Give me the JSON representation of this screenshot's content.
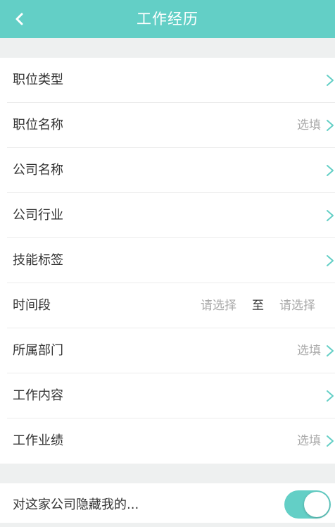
{
  "header": {
    "title": "工作经历",
    "back_icon": "chevron-left-icon"
  },
  "colors": {
    "accent": "#63cfc6",
    "background": "#eef0f0",
    "text": "#333333",
    "hint": "#a9a9a9"
  },
  "form": {
    "rows": [
      {
        "label": "职位类型",
        "hint": ""
      },
      {
        "label": "职位名称",
        "hint": "选填"
      },
      {
        "label": "公司名称",
        "hint": ""
      },
      {
        "label": "公司行业",
        "hint": ""
      },
      {
        "label": "技能标签",
        "hint": ""
      },
      {
        "label": "时间段",
        "start_placeholder": "请选择",
        "separator": "至",
        "end_placeholder": "请选择"
      },
      {
        "label": "所属部门",
        "hint": "选填"
      },
      {
        "label": "工作内容",
        "hint": ""
      },
      {
        "label": "工作业绩",
        "hint": "选填"
      }
    ]
  },
  "privacy": {
    "label": "对这家公司隐藏我的...",
    "toggle_on": true
  }
}
